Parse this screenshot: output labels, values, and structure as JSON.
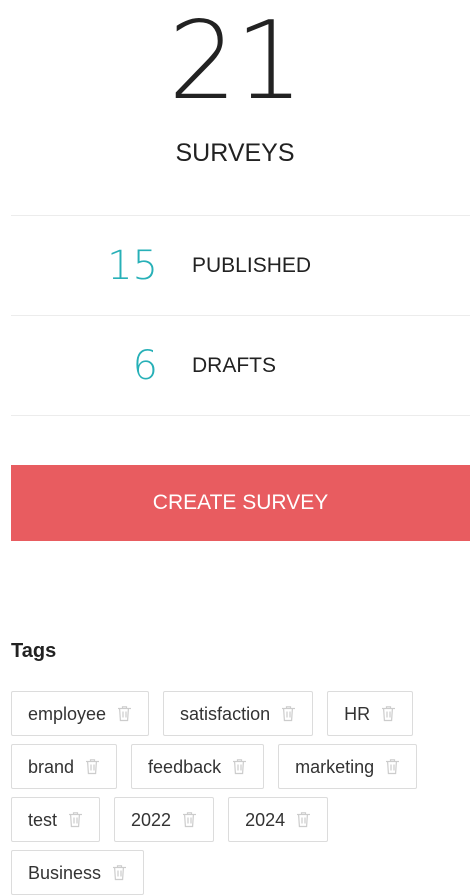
{
  "summary": {
    "total_count": "21",
    "total_label": "SURVEYS"
  },
  "stats": [
    {
      "value": "15",
      "label": "PUBLISHED"
    },
    {
      "value": "6",
      "label": "DRAFTS"
    }
  ],
  "actions": {
    "create_label": "CREATE SURVEY"
  },
  "tags_section": {
    "heading": "Tags",
    "items": [
      {
        "label": "employee",
        "icon": "trash-icon"
      },
      {
        "label": "satisfaction",
        "icon": "trash-icon"
      },
      {
        "label": "HR",
        "icon": "trash-icon"
      },
      {
        "label": "brand",
        "icon": "trash-icon"
      },
      {
        "label": "feedback",
        "icon": "trash-icon"
      },
      {
        "label": "marketing",
        "icon": "trash-icon"
      },
      {
        "label": "test",
        "icon": "trash-icon"
      },
      {
        "label": "2022",
        "icon": "trash-icon"
      },
      {
        "label": "2024",
        "icon": "trash-icon"
      },
      {
        "label": "Business",
        "icon": "trash-icon"
      }
    ]
  },
  "colors": {
    "accent_teal": "#27b0b7",
    "create_button": "#e85c60",
    "divider": "#ececec",
    "tag_border": "#dcdcdc",
    "trash_icon": "#cccccc"
  }
}
